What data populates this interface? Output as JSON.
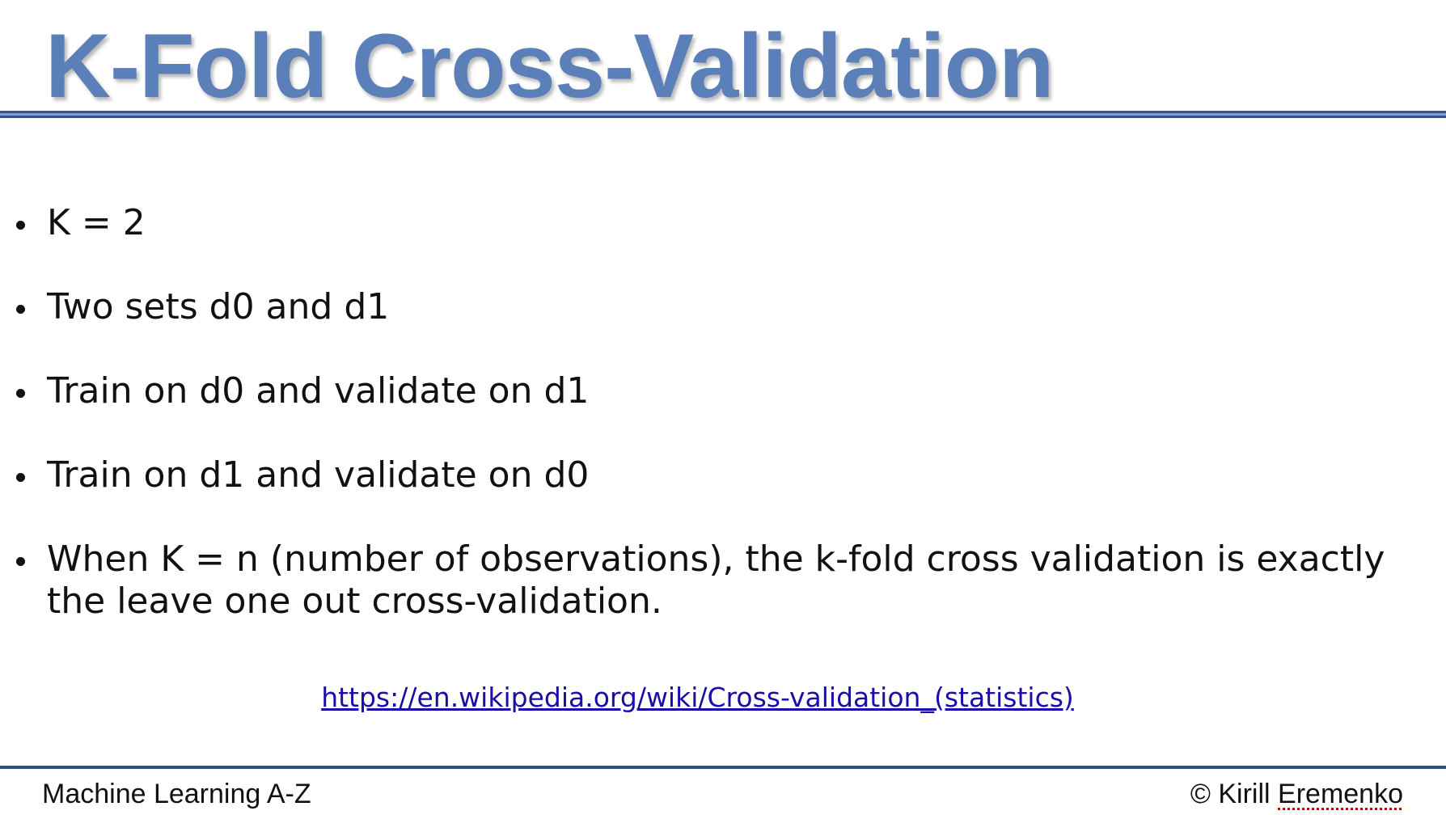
{
  "slide": {
    "title": "K-Fold Cross-Validation",
    "bullets": [
      {
        "text": "K = 2"
      },
      {
        "text": "Two sets d0 and d1"
      },
      {
        "text": "Train on d0 and validate on d1"
      },
      {
        "text": "Train on d1 and validate on d0"
      },
      {
        "text": "When K = n (number of observations), the k-fold cross validation is exactly the leave one out cross-validation."
      }
    ],
    "link_text": "https://en.wikipedia.org/wiki/Cross-validation_(statistics)",
    "footer": {
      "left": "Machine Learning A-Z",
      "copyright_symbol": "©",
      "author_first": "Kirill",
      "author_last": "Eremenko"
    }
  },
  "colors": {
    "title": "#5b7fb8",
    "rule": "#2f5597",
    "link": "#1a0dab",
    "text": "#111111"
  }
}
